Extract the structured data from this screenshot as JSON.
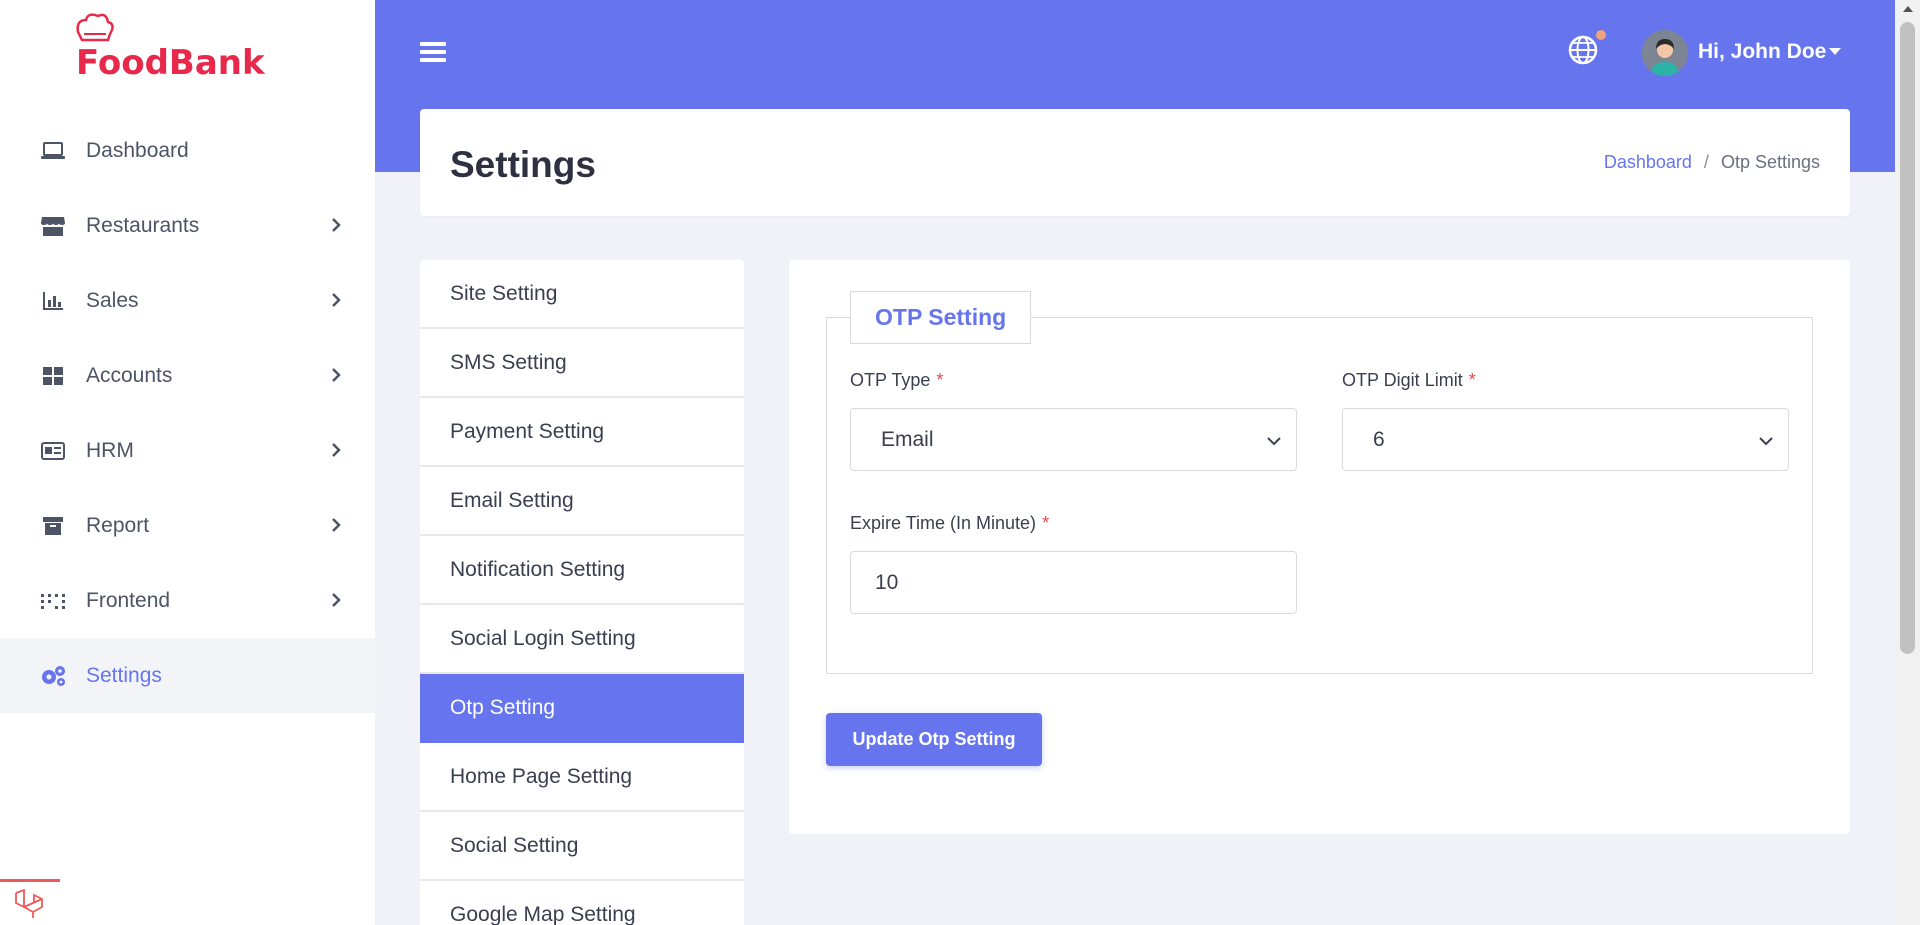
{
  "brand": {
    "logo_text": "FoodBank"
  },
  "sidebar": {
    "items": [
      {
        "label": "Dashboard",
        "icon": "laptop-icon",
        "has_submenu": false,
        "active": false
      },
      {
        "label": "Restaurants",
        "icon": "store-icon",
        "has_submenu": true,
        "active": false
      },
      {
        "label": "Sales",
        "icon": "chart-bar-icon",
        "has_submenu": true,
        "active": false
      },
      {
        "label": "Accounts",
        "icon": "grid-icon",
        "has_submenu": true,
        "active": false
      },
      {
        "label": "HRM",
        "icon": "id-card-icon",
        "has_submenu": true,
        "active": false
      },
      {
        "label": "Report",
        "icon": "archive-icon",
        "has_submenu": true,
        "active": false
      },
      {
        "label": "Frontend",
        "icon": "dots-grid-icon",
        "has_submenu": true,
        "active": false
      },
      {
        "label": "Settings",
        "icon": "gears-icon",
        "has_submenu": false,
        "active": true
      }
    ]
  },
  "header": {
    "user_greeting": "Hi, John Doe"
  },
  "page": {
    "title": "Settings",
    "breadcrumb": {
      "link": "Dashboard",
      "separator": "/",
      "current": "Otp Settings"
    }
  },
  "settings_menu": {
    "items": [
      {
        "label": "Site Setting",
        "active": false
      },
      {
        "label": "SMS Setting",
        "active": false
      },
      {
        "label": "Payment Setting",
        "active": false
      },
      {
        "label": "Email Setting",
        "active": false
      },
      {
        "label": "Notification Setting",
        "active": false
      },
      {
        "label": "Social Login Setting",
        "active": false
      },
      {
        "label": "Otp Setting",
        "active": true
      },
      {
        "label": "Home Page Setting",
        "active": false
      },
      {
        "label": "Social Setting",
        "active": false
      },
      {
        "label": "Google Map Setting",
        "active": false
      }
    ]
  },
  "otp_form": {
    "legend": "OTP Setting",
    "otp_type": {
      "label": "OTP Type",
      "required_mark": "*",
      "value": "Email"
    },
    "otp_digit_limit": {
      "label": "OTP Digit Limit",
      "required_mark": "*",
      "value": "6"
    },
    "expire_time": {
      "label": "Expire Time (In Minute)",
      "required_mark": "*",
      "value": "10"
    },
    "submit_label": "Update Otp Setting"
  },
  "colors": {
    "primary": "#6675ee",
    "required": "#e5484d",
    "logo_red": "#e8294b"
  }
}
